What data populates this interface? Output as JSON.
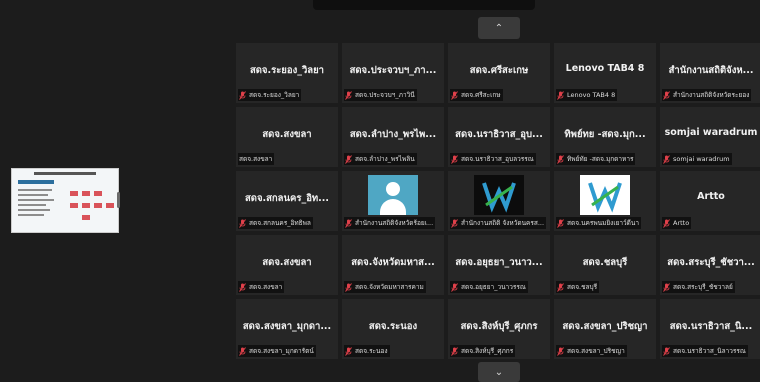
{
  "controls": {
    "scroll_up_glyph": "⌃",
    "scroll_down_glyph": "⌄"
  },
  "colors": {
    "background": "#1c1c1c",
    "tile": "#262626",
    "muted_icon": "#e0404a",
    "avatar": "#4fa7c4"
  },
  "participants": [
    {
      "name": "สดจ.ระยอง_วิลยา",
      "label": "สดจ.ระยอง_วิลยา",
      "muted": true
    },
    {
      "name": "สดจ.ประจวบฯ_ภา...",
      "label": "สดจ.ประจวบฯ_ภาวินี",
      "muted": true
    },
    {
      "name": "สดจ.ศรีสะเกษ",
      "label": "สดจ.ศรีสะเกษ",
      "muted": true
    },
    {
      "name": "Lenovo TAB4 8",
      "label": "Lenovo TAB4 8",
      "muted": true
    },
    {
      "name": "สำนักงานสถิติจังห...",
      "label": "สำนักงานสถิติจังหวัดระยอง",
      "muted": true
    },
    {
      "name": "สดจ.สงขลา",
      "label": "สดจ.สงขลา",
      "muted": false
    },
    {
      "name": "สดจ.ลำปาง_พรไพ...",
      "label": "สดจ.ลำปาง_พรไพลิน",
      "muted": true
    },
    {
      "name": "สดจ.นราธิวาส_อุบ...",
      "label": "สดจ.นราธิวาส_อุบลวรรณ",
      "muted": true
    },
    {
      "name": "ทิพย์ทย -สดจ.มุก...",
      "label": "ทิพย์ทัย -สดจ.มุกดาหาร",
      "muted": true
    },
    {
      "name": "somjai waradrum",
      "label": "somjai waradrum",
      "muted": true
    },
    {
      "name": "สดจ.สกลนคร_อิท...",
      "label": "สดจ.สกลนคร_อิทธิพล",
      "muted": true
    },
    {
      "name": "",
      "label": "สำนักงานสถิติจังหวัดร้อยเ...",
      "muted": true,
      "avatar": true
    },
    {
      "name": "",
      "label": "สำนักงานสถิติ จังหวัดนครส...",
      "muted": true,
      "logo": "dark"
    },
    {
      "name": "",
      "label": "สดจ.นครพนมยิงเยาว์ดีนา",
      "muted": true,
      "logo": "light"
    },
    {
      "name": "Artto",
      "label": "Artto",
      "muted": true
    },
    {
      "name": "สดจ.สงขลา",
      "label": "สดจ.สงขลา",
      "muted": true
    },
    {
      "name": "สดจ.จังหวัดมหาส...",
      "label": "สดจ.จังหวัดมหาสารคาม",
      "muted": true
    },
    {
      "name": "สดจ.อยุธยา_วนาว...",
      "label": "สดจ.อยุธยา_วนาวรรณ",
      "muted": true
    },
    {
      "name": "สดจ.ชลบุรี",
      "label": "สดจ.ชลบุรี",
      "muted": true
    },
    {
      "name": "สดจ.สระบุรี_ชัชวา...",
      "label": "สดจ.สระบุรี_ชัชวาลย์",
      "muted": true
    },
    {
      "name": "สดจ.สงขลา_มุกดา...",
      "label": "สดจ.สงขลา_มุกดารัตน์",
      "muted": true
    },
    {
      "name": "สดจ.ระนอง",
      "label": "สดจ.ระนอง",
      "muted": true
    },
    {
      "name": "สดจ.สิงห์บุรี_ศุภกร",
      "label": "สดจ.สิงห์บุรี_ศุภกร",
      "muted": true
    },
    {
      "name": "สดจ.สงขลา_ปริชญา",
      "label": "สดจ.สงขลา_ปริชญา",
      "muted": true
    },
    {
      "name": "สดจ.นราธิวาส_นิ...",
      "label": "สดจ.นราธิวาส_นิลาวรรณ",
      "muted": true
    }
  ]
}
